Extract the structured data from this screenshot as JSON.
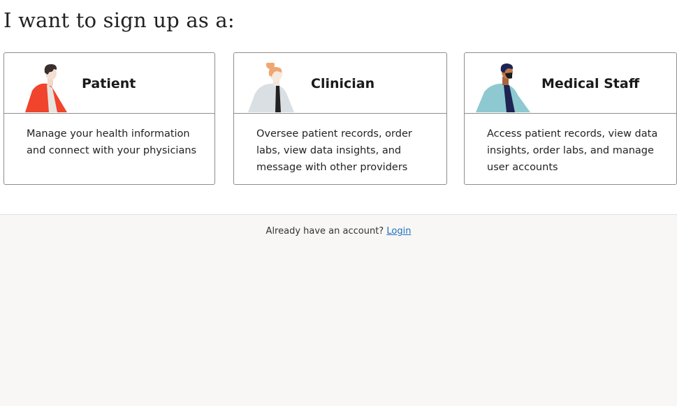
{
  "heading": "I want to sign up as a:",
  "cards": [
    {
      "title": "Patient",
      "description": "Manage your health information and connect with your physicians",
      "illustration": "patient-illustration"
    },
    {
      "title": "Clinician",
      "description": "Oversee patient records, order labs, view data insights, and message with other providers",
      "illustration": "clinician-illustration"
    },
    {
      "title": "Medical Staff",
      "description": "Access patient records, view data insights, order labs, and manage user accounts",
      "illustration": "medical-staff-illustration"
    }
  ],
  "footer": {
    "prompt": "Already have an account?",
    "login_label": "Login"
  },
  "colors": {
    "patient_shirt": "#f0442c",
    "clinician_coat": "#d9dfe3",
    "clinician_hair": "#f0a672",
    "staff_coat": "#8ec9d1",
    "staff_skin": "#c07a4e",
    "link": "#1f6fbf",
    "footer_bg": "#f8f7f5"
  }
}
